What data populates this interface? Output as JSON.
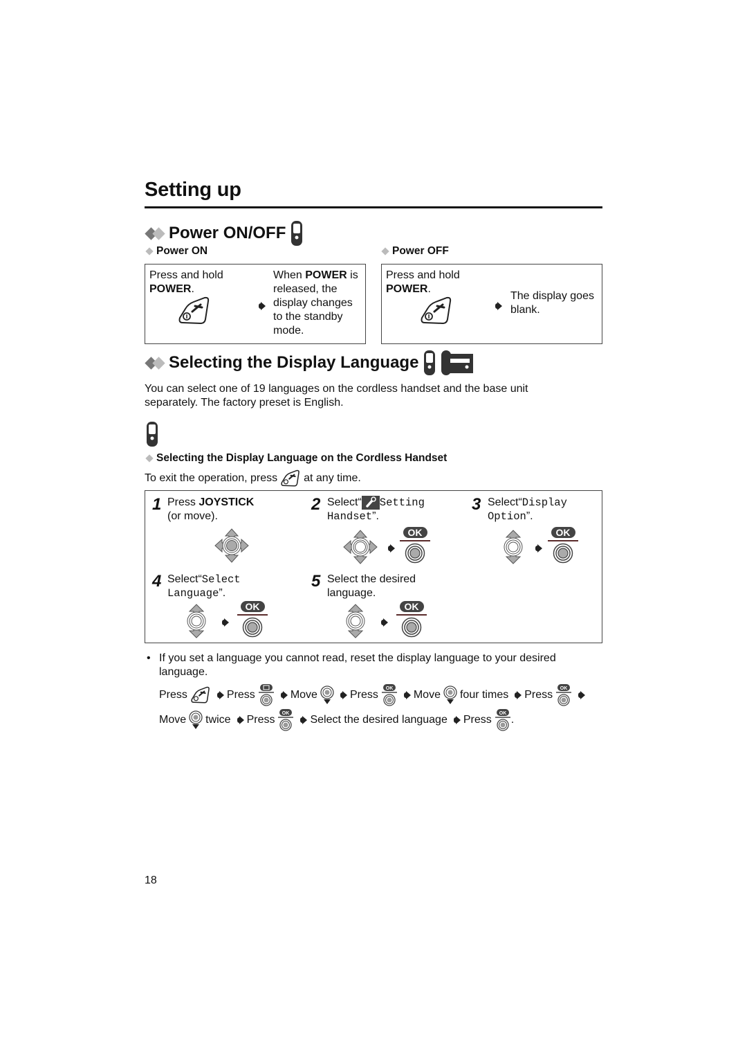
{
  "page": {
    "title": "Setting up",
    "page_number": "18"
  },
  "power": {
    "heading": "Power ON/OFF",
    "on": {
      "subheading": "Power ON",
      "instruction_line1": "Press and hold",
      "instruction_key": "POWER",
      "instruction_end": ".",
      "result_pre": "When ",
      "result_key": "POWER",
      "result_post": " is",
      "result_lines": [
        "released, the",
        "display changes",
        "to the standby",
        "mode."
      ]
    },
    "off": {
      "subheading": "Power OFF",
      "instruction_line1": "Press and hold",
      "instruction_key": "POWER",
      "instruction_end": ".",
      "result_lines": [
        "The display goes",
        "blank."
      ]
    }
  },
  "language": {
    "heading": "Selecting the Display Language",
    "intro_line1": "You can select one of 19 languages on the cordless handset and the base unit",
    "intro_line2": "separately. The factory preset is English.",
    "handset": {
      "subheading": "Selecting the Display Language on the Cordless Handset",
      "exit_pre": "To exit the operation, press",
      "exit_post": "at any time.",
      "steps": [
        {
          "num": "1",
          "pre": "Press ",
          "key": "JOYSTICK",
          "line2": "(or move)."
        },
        {
          "num": "2",
          "pre": "Select“",
          "mono1": " Setting",
          "mono2": "Handset",
          "post": "”."
        },
        {
          "num": "3",
          "pre": "Select“",
          "mono1": "Display",
          "mono2": "Option",
          "post": "”."
        },
        {
          "num": "4",
          "pre": "Select“",
          "mono1": "Select",
          "mono2": "Language",
          "post": "”."
        },
        {
          "num": "5",
          "line1": "Select the desired",
          "line2": "language."
        }
      ],
      "ok_label": "OK"
    },
    "note": {
      "bullet": "•",
      "line1": "If you set a language you cannot read, reset the display language to your desired",
      "line2": "language.",
      "seq1": [
        "Press",
        "Press",
        "Move",
        "Press",
        "Move",
        "four times",
        "Press"
      ],
      "seq2": [
        "Move",
        "twice",
        "Press",
        "Select the desired language",
        "Press",
        "."
      ]
    }
  }
}
